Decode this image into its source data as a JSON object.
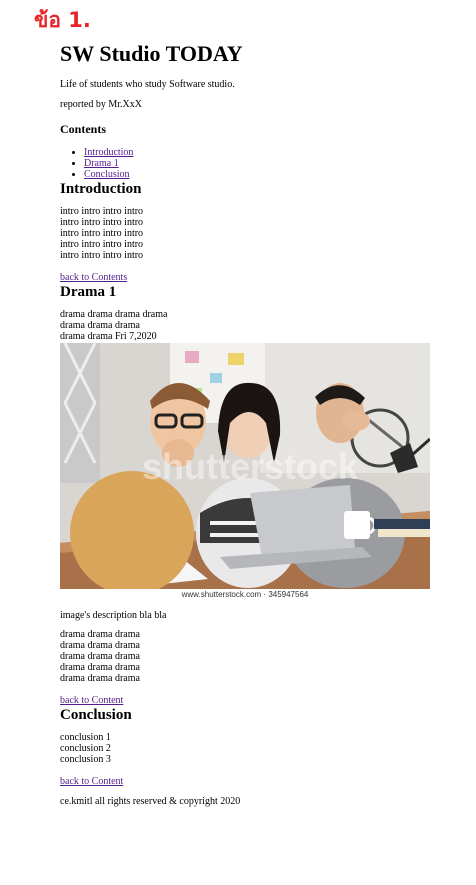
{
  "header_label": "ข้อ 1.",
  "site": {
    "title": "SW Studio TODAY",
    "subtitle": "Life of students who study Software studio.",
    "reporter": "reported by Mr.XxX"
  },
  "contents": {
    "heading": "Contents",
    "items": [
      "Introduction",
      "Drama 1",
      "Conclusion"
    ]
  },
  "introduction": {
    "heading": "Introduction",
    "lines": [
      "intro intro intro intro",
      "intro intro intro intro",
      "intro intro intro intro",
      "intro intro intro intro",
      "intro intro intro intro"
    ],
    "back_link": "back to Contents"
  },
  "drama": {
    "heading": "Drama 1",
    "lines_before": [
      "drama drama drama drama",
      "drama drama drama",
      "drama drama Fri 7,2020"
    ],
    "image_watermark": "shutterstock",
    "image_caption": "www.shutterstock.com · 345947564",
    "image_description": "image's description bla bla",
    "lines_after": [
      "drama drama drama",
      "drama drama drama",
      "drama drama drama",
      "drama drama drama",
      "drama drama drama"
    ],
    "back_link": "back to Content"
  },
  "conclusion": {
    "heading": "Conclusion",
    "lines": [
      "conclusion 1",
      "conclusion 2",
      "conclusion 3"
    ],
    "back_link": "back to Content"
  },
  "footer": "ce.kmitl all rights reserved & copyright 2020",
  "colors": {
    "header_label": "#e8262a",
    "link": "#551a8b"
  }
}
